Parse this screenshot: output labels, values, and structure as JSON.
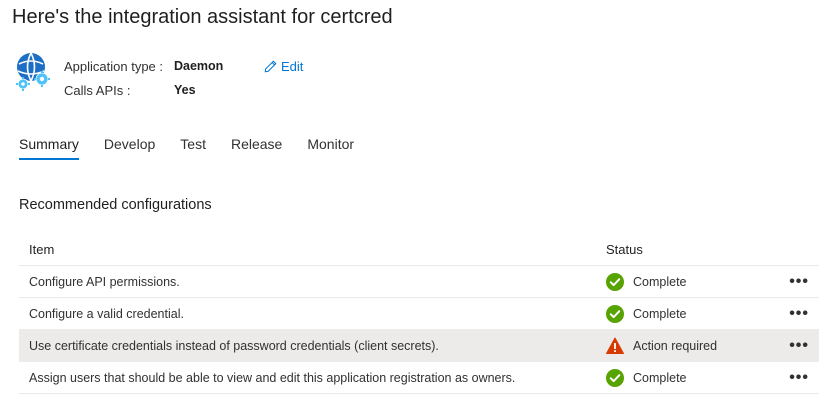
{
  "title": "Here's the integration assistant for certcred",
  "app": {
    "type_label": "Application type :",
    "type_value": "Daemon",
    "calls_label": "Calls APIs :",
    "calls_value": "Yes",
    "edit_label": "Edit",
    "icon": "daemon-app-icon"
  },
  "tabs": [
    {
      "label": "Summary",
      "active": true
    },
    {
      "label": "Develop",
      "active": false
    },
    {
      "label": "Test",
      "active": false
    },
    {
      "label": "Release",
      "active": false
    },
    {
      "label": "Monitor",
      "active": false
    }
  ],
  "section": {
    "title": "Recommended configurations"
  },
  "table": {
    "headers": {
      "item": "Item",
      "status": "Status"
    },
    "rows": [
      {
        "item": "Configure API permissions.",
        "status": "Complete",
        "status_icon": "check-circle-icon"
      },
      {
        "item": "Configure a valid credential.",
        "status": "Complete",
        "status_icon": "check-circle-icon"
      },
      {
        "item": "Use certificate credentials instead of password credentials (client secrets).",
        "status": "Action required",
        "status_icon": "warning-icon"
      },
      {
        "item": "Assign users that should be able to view and edit this application registration as owners.",
        "status": "Complete",
        "status_icon": "check-circle-icon"
      }
    ],
    "more_label": "•••"
  },
  "colors": {
    "accent": "#0078d4",
    "complete": "#57a300",
    "warning": "#d83b01",
    "highlight_row": "#edebe9"
  }
}
